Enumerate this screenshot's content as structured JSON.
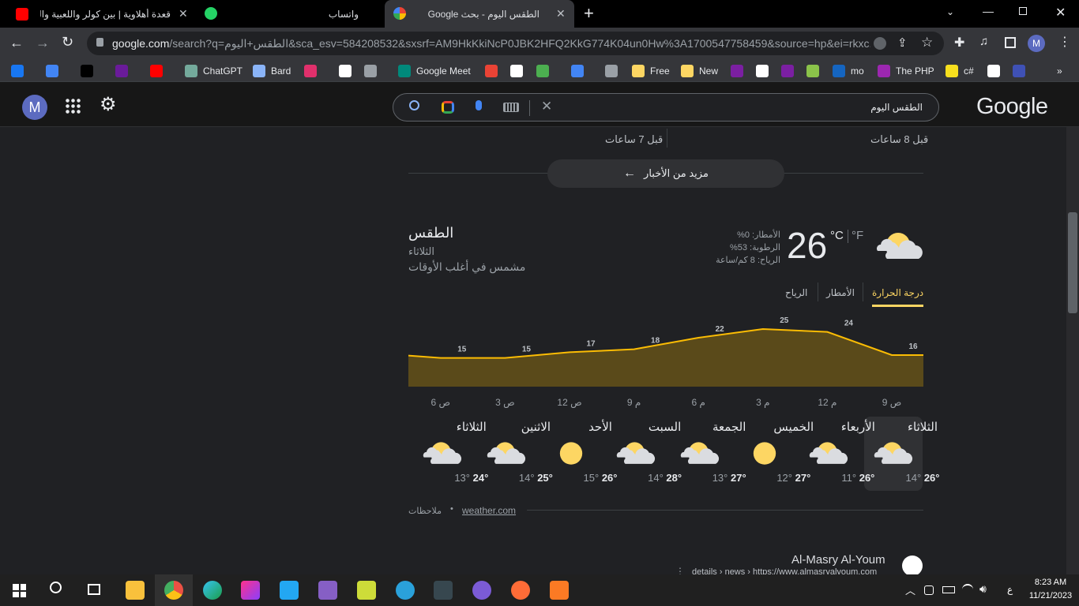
{
  "tabs": [
    {
      "title": "قعدة أهلاوية | بين كولر واللعبية والـ",
      "active": false
    },
    {
      "title": "واتساب",
      "active": false
    },
    {
      "title": "الطقس اليوم - بحث Google",
      "active": true
    }
  ],
  "toolbar": {
    "url_host": "google.com",
    "url_rest": "/search?q=الطقس+اليوم&sca_esv=584208532&sxsrf=AM9HkKkiNcP0JBK2HFQ2KkG774K04un0Hw%3A1700547758459&source=hp&ei=rkxc...",
    "profile_letter": "M"
  },
  "bookmarks": [
    {
      "label": "",
      "icon": "facebook-icon",
      "color": "#1877f2"
    },
    {
      "label": "",
      "icon": "google-icon",
      "color": "#4285f4"
    },
    {
      "label": "",
      "icon": "x-icon",
      "color": "#000000"
    },
    {
      "label": "",
      "icon": "app-icon",
      "color": "#6a1b9a"
    },
    {
      "label": "",
      "icon": "youtube-icon",
      "color": "#ff0000"
    },
    {
      "label": "ChatGPT",
      "icon": "chatgpt-icon",
      "color": "#74aa9c"
    },
    {
      "label": "Bard",
      "icon": "bard-icon",
      "color": "#8ab4f8"
    },
    {
      "label": "",
      "icon": "instagram-icon",
      "color": "#e1306c"
    },
    {
      "label": "",
      "icon": "notion-icon",
      "color": "#ffffff"
    },
    {
      "label": "",
      "icon": "globe-icon",
      "color": "#9aa0a6"
    },
    {
      "label": "Google Meet",
      "icon": "meet-icon",
      "color": "#00897b"
    },
    {
      "label": "",
      "icon": "heart-icon",
      "color": "#ea4335"
    },
    {
      "label": "",
      "icon": "github-icon",
      "color": "#ffffff"
    },
    {
      "label": "",
      "icon": "app2-icon",
      "color": "#4caf50"
    },
    {
      "label": "",
      "icon": "translate-icon",
      "color": "#4285f4"
    },
    {
      "label": "",
      "icon": "layers-icon",
      "color": "#9aa0a6"
    },
    {
      "label": "Free",
      "icon": "folder-icon",
      "color": "#fdd663"
    },
    {
      "label": "New",
      "icon": "folder-icon",
      "color": "#fdd663"
    },
    {
      "label": "",
      "icon": "k-icon",
      "color": "#7b1fa2"
    },
    {
      "label": "",
      "icon": "github-icon",
      "color": "#ffffff"
    },
    {
      "label": "",
      "icon": "mail-icon",
      "color": "#7b1fa2"
    },
    {
      "label": "",
      "icon": "app3-icon",
      "color": "#8bc34a"
    },
    {
      "label": "mo",
      "icon": "paypal-icon",
      "color": "#1565c0"
    },
    {
      "label": "The PHP",
      "icon": "php-icon",
      "color": "#9c27b0"
    },
    {
      "label": "c#",
      "icon": "js-icon",
      "color": "#f7df1e"
    },
    {
      "label": "",
      "icon": "github-icon",
      "color": "#ffffff"
    },
    {
      "label": "",
      "icon": "app4-icon",
      "color": "#3f51b5"
    }
  ],
  "google": {
    "avatar": "M",
    "query": "الطقس اليوم",
    "logo": "Google"
  },
  "news": {
    "time_right": "قبل 8 ساعات",
    "time_left": "قبل 7 ساعات",
    "more_label": "مزيد من الأخبار"
  },
  "weather": {
    "title": "الطقس",
    "day": "الثلاثاء",
    "condition": "مشمس في أغلب الأوقات",
    "temp": "26",
    "unit_c": "°C",
    "unit_f": "°F",
    "precip": "الأمطار: 0%",
    "humidity": "الرطوبة: 53%",
    "wind": "الرياح: 8 كم/ساعة",
    "tabs": [
      "درجة الحرارة",
      "الأمطار",
      "الرياح"
    ],
    "hours": [
      "9 ص",
      "12 م",
      "3 م",
      "6 م",
      "9 م",
      "12 ص",
      "3 ص",
      "6 ص"
    ],
    "days": [
      {
        "name": "الثلاثاء",
        "high": "26°",
        "low": "14°",
        "icon": "partly-cloudy-icon"
      },
      {
        "name": "الأربعاء",
        "high": "26°",
        "low": "11°",
        "icon": "partly-cloudy-icon"
      },
      {
        "name": "الخميس",
        "high": "27°",
        "low": "12°",
        "icon": "sunny-icon"
      },
      {
        "name": "الجمعة",
        "high": "27°",
        "low": "13°",
        "icon": "partly-cloudy-icon"
      },
      {
        "name": "السبت",
        "high": "28°",
        "low": "14°",
        "icon": "partly-cloudy-icon"
      },
      {
        "name": "الأحد",
        "high": "26°",
        "low": "15°",
        "icon": "sunny-icon"
      },
      {
        "name": "الاثنين",
        "high": "25°",
        "low": "14°",
        "icon": "partly-cloudy-icon"
      },
      {
        "name": "الثلاثاء",
        "high": "24°",
        "low": "13°",
        "icon": "partly-cloudy-icon"
      }
    ],
    "source": "weather.com",
    "feedback": "ملاحظات"
  },
  "chart_data": {
    "type": "area",
    "x": [
      "9 ص",
      "12 م",
      "3 م",
      "6 م",
      "9 م",
      "12 ص",
      "3 ص",
      "6 ص"
    ],
    "series": [
      {
        "values": [
          16,
          24,
          25,
          22,
          18,
          17,
          15,
          15
        ]
      }
    ],
    "colors": {
      "line": "#fbbc04",
      "fill": "#5a4a1a"
    }
  },
  "result": {
    "site": "Al-Masry Al-Youm",
    "path": "details › news › https://www.almasryalyoum.com"
  },
  "taskbar": {
    "time": "8:23 AM",
    "date": "11/21/2023",
    "lang": "ع"
  }
}
